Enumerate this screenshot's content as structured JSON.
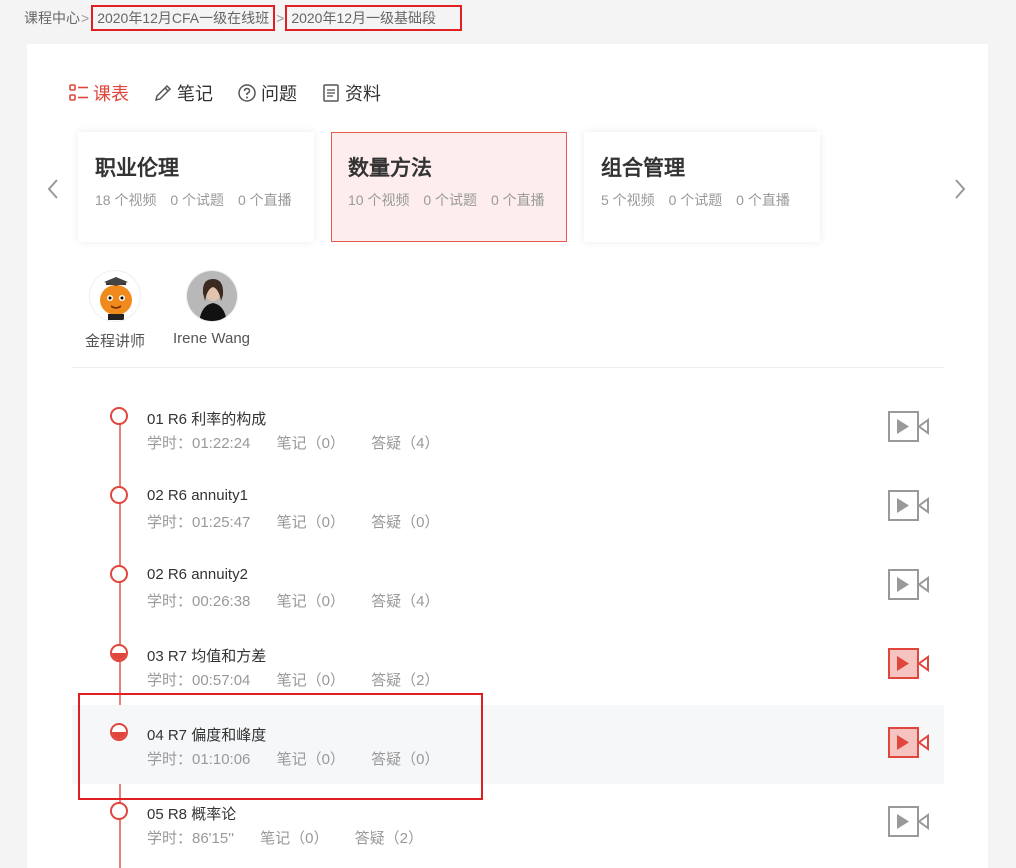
{
  "breadcrumb": {
    "root": "课程中心",
    "sep": ">",
    "course": "2020年12月CFA一级在线班",
    "stage": "2020年12月一级基础段"
  },
  "tabs": [
    {
      "label": "课表",
      "icon": "schedule-icon",
      "active": true
    },
    {
      "label": "笔记",
      "icon": "pencil-icon",
      "active": false
    },
    {
      "label": "问题",
      "icon": "question-icon",
      "active": false
    },
    {
      "label": "资料",
      "icon": "document-icon",
      "active": false
    }
  ],
  "subjects": [
    {
      "name": "职业伦理",
      "videos": "18 个视频",
      "tests": "0 个试题",
      "lives": "0 个直播",
      "active": false
    },
    {
      "name": "数量方法",
      "videos": "10 个视频",
      "tests": "0 个试题",
      "lives": "0 个直播",
      "active": true
    },
    {
      "name": "组合管理",
      "videos": "5 个视频",
      "tests": "0 个试题",
      "lives": "0 个直播",
      "active": false
    }
  ],
  "teachers": [
    {
      "name": "金程讲师"
    },
    {
      "name": "Irene Wang"
    }
  ],
  "lessons": [
    {
      "title": "01 R6 利率的构成",
      "duration": "学时：01:22:24",
      "notes": "笔记（0）",
      "qa": "答疑（4）",
      "status": "none"
    },
    {
      "title": "02 R6 annuity1",
      "duration": "学时：01:25:47",
      "notes": "笔记（0）",
      "qa": "答疑（0）",
      "status": "none"
    },
    {
      "title": "02 R6 annuity2",
      "duration": "学时：00:26:38",
      "notes": "笔记（0）",
      "qa": "答疑（4）",
      "status": "none"
    },
    {
      "title": "03 R7 均值和方差",
      "duration": "学时：00:57:04",
      "notes": "笔记（0）",
      "qa": "答疑（2）",
      "status": "half"
    },
    {
      "title": "04 R7 偏度和峰度",
      "duration": "学时：01:10:06",
      "notes": "笔记（0）",
      "qa": "答疑（0）",
      "status": "half"
    },
    {
      "title": "05 R8 概率论",
      "duration": "学时：86'15''",
      "notes": "笔记（0）",
      "qa": "答疑（2）",
      "status": "none"
    }
  ],
  "colors": {
    "accent": "#e0463c",
    "highlight_box": "#e02020"
  }
}
